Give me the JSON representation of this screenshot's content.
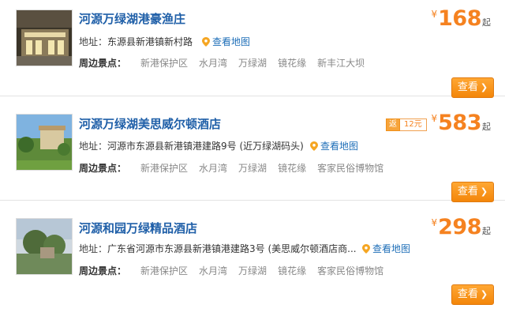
{
  "labels": {
    "address_prefix": "地址：",
    "spots_label": "周边景点：",
    "map_link": "查看地图",
    "view_button": "查看",
    "currency": "¥",
    "price_suffix": "起"
  },
  "hotels": [
    {
      "name": "河源万绿湖港豪渔庄",
      "address": "东源县新港镇新村路",
      "spots": [
        "新港保护区",
        "水月湾",
        "万绿湖",
        "镜花缘",
        "新丰江大坝"
      ],
      "price": "168"
    },
    {
      "name": "河源万绿湖美思威尔顿酒店",
      "address": "河源市东源县新港镇港建路9号 (近万绿湖码头)",
      "spots": [
        "新港保护区",
        "水月湾",
        "万绿湖",
        "镜花缘",
        "客家民俗博物馆"
      ],
      "price": "583",
      "cashback": {
        "label": "返",
        "value": "12元"
      }
    },
    {
      "name": "河源和园万绿精品酒店",
      "address": "广东省河源市东源县新港镇港建路3号 (美思威尔顿酒店商...",
      "spots": [
        "新港保护区",
        "水月湾",
        "万绿湖",
        "镜花缘",
        "客家民俗博物馆"
      ],
      "price": "298"
    }
  ],
  "colors": {
    "hotel_name": "#1f5fa8",
    "price": "#f58220",
    "button": "#f3860a",
    "map_link": "#1f6fb8",
    "spot_text": "#888888"
  }
}
